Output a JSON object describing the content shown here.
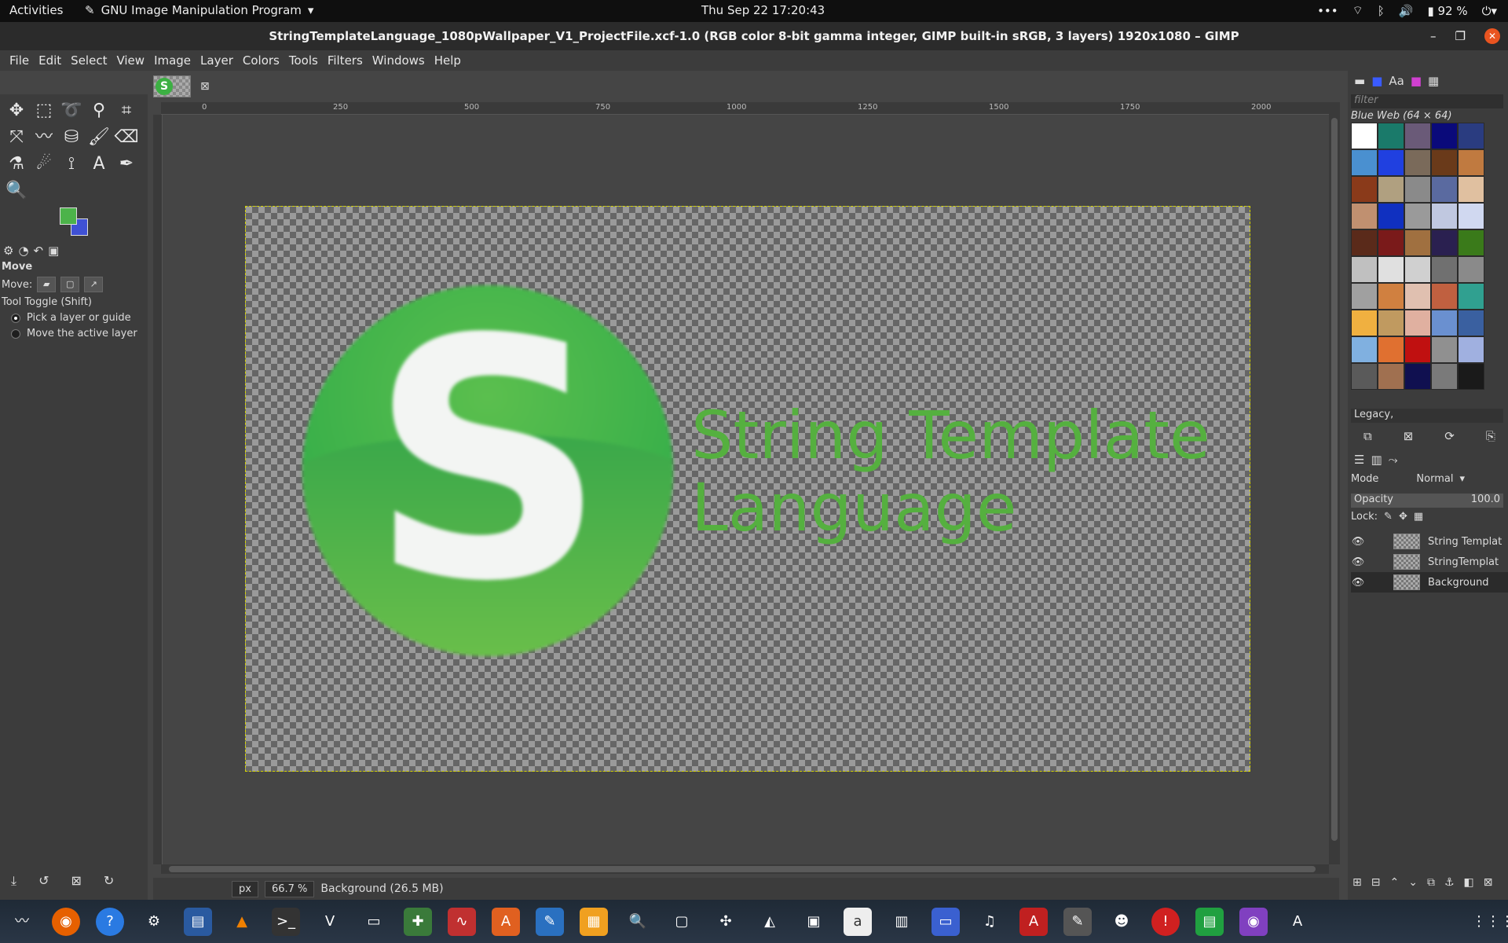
{
  "topbar": {
    "activities": "Activities",
    "app_menu": "GNU Image Manipulation Program",
    "clock": "Thu Sep 22  17:20:43",
    "battery": "92 %"
  },
  "window": {
    "title": "StringTemplateLanguage_1080pWallpaper_V1_ProjectFile.xcf-1.0 (RGB color 8-bit gamma integer, GIMP built-in sRGB, 3 layers) 1920x1080 – GIMP"
  },
  "menu": [
    "File",
    "Edit",
    "Select",
    "View",
    "Image",
    "Layer",
    "Colors",
    "Tools",
    "Filters",
    "Windows",
    "Help"
  ],
  "tool_options": {
    "title": "Move",
    "move_label": "Move:",
    "toggle_label": "Tool Toggle  (Shift)",
    "option1": "Pick a layer or guide",
    "option2": "Move the active layer"
  },
  "colors": {
    "foreground": "#4cb34a",
    "background": "#3f51d4"
  },
  "ruler": {
    "ticks": [
      "0",
      "250",
      "500",
      "750",
      "1000",
      "1250",
      "1500",
      "1750",
      "2000"
    ]
  },
  "canvas": {
    "logo_letter": "S",
    "title_line1": "String Template",
    "title_line2": "Language"
  },
  "status": {
    "unit": "px",
    "zoom": "66.7 %",
    "info": "Background (26.5 MB)"
  },
  "patterns": {
    "filter_placeholder": "filter",
    "title": "Blue Web (64 × 64)",
    "tag": "Legacy,"
  },
  "layers_panel": {
    "mode_label": "Mode",
    "mode_value": "Normal",
    "opacity_label": "Opacity",
    "opacity_value": "100.0",
    "lock_label": "Lock:",
    "layers": [
      {
        "name": "String Templat"
      },
      {
        "name": "StringTemplat"
      },
      {
        "name": "Background"
      }
    ]
  }
}
